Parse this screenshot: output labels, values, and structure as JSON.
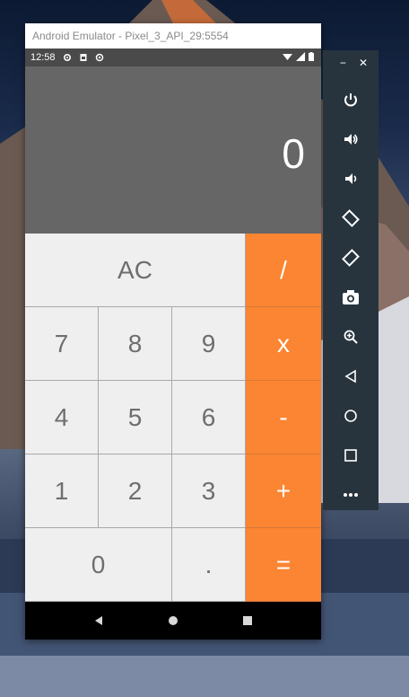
{
  "window": {
    "title": "Android Emulator - Pixel_3_API_29:5554"
  },
  "status_bar": {
    "time": "12:58"
  },
  "calculator": {
    "display_value": "0",
    "keys": {
      "ac": "AC",
      "divide": "/",
      "seven": "7",
      "eight": "8",
      "nine": "9",
      "multiply": "x",
      "four": "4",
      "five": "5",
      "six": "6",
      "minus": "-",
      "one": "1",
      "two": "2",
      "three": "3",
      "plus": "+",
      "zero": "0",
      "dot": ".",
      "equals": "="
    }
  },
  "side_panel": {
    "minimize": "−",
    "close": "✕"
  },
  "colors": {
    "operator": "#fb8532",
    "display_bg": "#666666",
    "key_bg": "#efefef"
  }
}
